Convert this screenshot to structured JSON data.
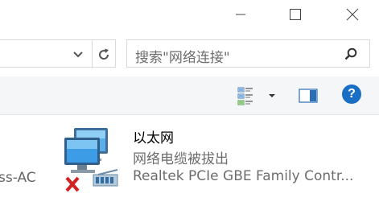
{
  "window": {
    "minimize_icon": "minimize-icon",
    "maximize_icon": "maximize-icon",
    "close_icon": "close-icon"
  },
  "address": {
    "dropdown_icon": "chevron-down-icon",
    "refresh_icon": "refresh-icon"
  },
  "search": {
    "placeholder": "搜索\"网络连接\"",
    "icon": "search-icon"
  },
  "toolbar": {
    "view_icon": "view-options-icon",
    "pane_icon": "preview-pane-icon",
    "help_label": "?"
  },
  "content": {
    "left_item_partial": "ss-AC",
    "adapter": {
      "name": "以太网",
      "status": "网络电缆被拔出",
      "device": "Realtek PCIe GBE Family Contr...",
      "icon": "ethernet-disconnected-icon"
    }
  },
  "colors": {
    "accent_blue": "#1a6fc4",
    "error_red": "#d32020",
    "toolbar_bg": "#f5f6f7"
  }
}
